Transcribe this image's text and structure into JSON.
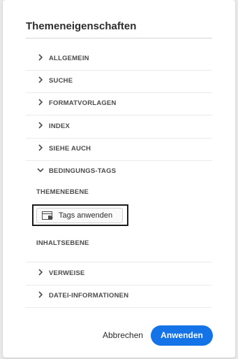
{
  "dialog": {
    "title": "Themeneigenschaften",
    "sections": [
      {
        "label": "ALLGEMEIN",
        "expanded": false,
        "icon": "chevron-right-icon"
      },
      {
        "label": "SUCHE",
        "expanded": false,
        "icon": "chevron-right-icon"
      },
      {
        "label": "FORMATVORLAGEN",
        "expanded": false,
        "icon": "chevron-right-icon"
      },
      {
        "label": "INDEX",
        "expanded": false,
        "icon": "chevron-right-icon"
      },
      {
        "label": "SIEHE AUCH",
        "expanded": false,
        "icon": "chevron-right-icon"
      },
      {
        "label": "BEDINGUNGS-TAGS",
        "expanded": true,
        "icon": "chevron-down-icon"
      },
      {
        "label": "VERWEISE",
        "expanded": false,
        "icon": "chevron-right-icon"
      },
      {
        "label": "DATEI-INFORMATIONEN",
        "expanded": false,
        "icon": "chevron-right-icon"
      }
    ],
    "conditional_tags": {
      "topic_level_label": "THEMENEBENE",
      "apply_tags_button": "Tags anwenden",
      "content_level_label": "INHALTSEBENE"
    },
    "footer": {
      "cancel_label": "Abbrechen",
      "apply_label": "Anwenden"
    }
  },
  "colors": {
    "accent": "#1473e6",
    "text": "#2c2c2c",
    "section_text": "#4b4b4b"
  }
}
